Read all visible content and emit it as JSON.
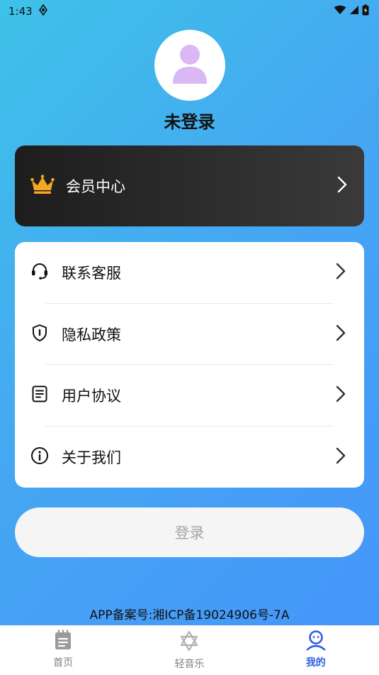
{
  "status_bar": {
    "time": "1:43",
    "icons": [
      "app-notification-icon",
      "wifi-icon",
      "cellular-signal-icon",
      "battery-icon"
    ]
  },
  "profile": {
    "avatar_icon": "user-avatar-icon",
    "login_status": "未登录"
  },
  "vip": {
    "icon": "crown-icon",
    "label": "会员中心"
  },
  "menu": {
    "items": [
      {
        "icon": "headset-icon",
        "label": "联系客服"
      },
      {
        "icon": "shield-icon",
        "label": "隐私政策"
      },
      {
        "icon": "document-icon",
        "label": "用户协议"
      },
      {
        "icon": "info-icon",
        "label": "关于我们"
      }
    ]
  },
  "login_button": {
    "label": "登录"
  },
  "footer": {
    "icp": "APP备案号:湘ICP备19024906号-7A"
  },
  "bottom_nav": {
    "items": [
      {
        "icon": "home-icon",
        "label": "首页",
        "active": false
      },
      {
        "icon": "star-of-david-icon",
        "label": "轻音乐",
        "active": false
      },
      {
        "icon": "user-icon",
        "label": "我的",
        "active": true
      }
    ]
  },
  "colors": {
    "accent_blue": "#2d5fe0",
    "avatar_purple": "#d9b8f5",
    "crown_orange": "#f5a623",
    "vip_card_dark": "#262626"
  }
}
